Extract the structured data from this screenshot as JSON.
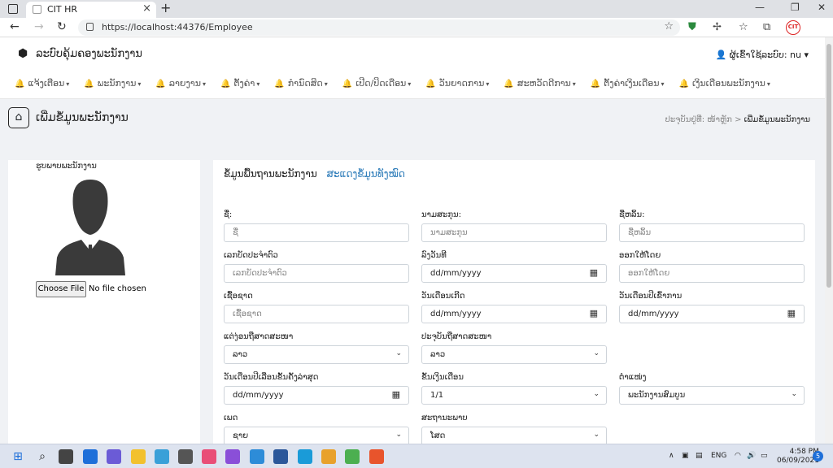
{
  "browser": {
    "tab_title": "CIT HR",
    "url": "https://localhost:44376/Employee",
    "new_tab_label": "+",
    "close_tab_label": "×",
    "profile_badge": "CIT"
  },
  "app": {
    "brand": "ລະບົບຄຸ້ມຄອງພະນັກງານ",
    "user_label": "ຜູ້ເຂົ້າໃຊ້ລະບົບ: nu"
  },
  "menu": [
    {
      "label": "ແຈ້ງເຕືອນ"
    },
    {
      "label": "ພະນັກງານ"
    },
    {
      "label": "ລາຍງານ"
    },
    {
      "label": "ຕັ້ງຄ່າ"
    },
    {
      "label": "ກຳນົດສິດ"
    },
    {
      "label": "ເປີດ/ປິດເດືອນ"
    },
    {
      "label": "ວັນຍາດການ"
    },
    {
      "label": "ສະຫວັດດີການ"
    },
    {
      "label": "ຕັ້ງຄ່າເງິນເດືອນ"
    },
    {
      "label": "ເງິນເດືອນພະນັກງານ"
    }
  ],
  "page": {
    "title": "ເພີ່ມຂໍ້ມູນພະນັກງານ",
    "breadcrumb": {
      "item1": "ປະຈຸບັນຢູ່ທີ່:",
      "item2": "ໜ້າຫຼັກ",
      "separator": ">",
      "active": "ເພີ່ມຂໍ້ມູນພະນັກງານ"
    }
  },
  "photo": {
    "label": "ຮູບພາບພະນັກງານ",
    "choose_button": "Choose File",
    "no_file": "No file chosen"
  },
  "form": {
    "tab_active": "ຂໍ້ມູນພື້ນຖານພະນັກງານ",
    "tab_link": "ສະແດງຂໍ້ມູນທັງໝົດ",
    "fields": {
      "first_name": {
        "label": "ຊື່:",
        "placeholder": "ຊື່"
      },
      "last_name": {
        "label": "ນາມສະກຸນ:",
        "placeholder": "ນາມສະກຸນ"
      },
      "nickname": {
        "label": "ຊື່ຫລິ້ນ:",
        "placeholder": "ຊື່ຫລິ້ນ"
      },
      "id_card": {
        "label": "ເລກບັດປະຈຳຕົວ",
        "placeholder": "ເລກບັດປະຈຳຕົວ"
      },
      "valid_date": {
        "label": "ລົງວັນທີ",
        "placeholder": "dd/mm/yyyy"
      },
      "issued_by": {
        "label": "ອອກໃຫ້ໂດຍ",
        "placeholder": "ອອກໃຫ້ໂດຍ"
      },
      "ethnicity": {
        "label": "ເຊື້ອຊາດ",
        "placeholder": "ເຊື້ອຊາດ"
      },
      "birth_date": {
        "label": "ວັນເດືອນເກີດ",
        "placeholder": "dd/mm/yyyy"
      },
      "start_date": {
        "label": "ວັນເດືອນປີເຂົ້າການ",
        "placeholder": "dd/mm/yyyy"
      },
      "religion": {
        "label": "ແຕ່ງ່ອນຖືສາດສະໜາ",
        "value": "ລາວ"
      },
      "current_religion": {
        "label": "ປະຈຸບັນຖືສາດສະໜາ",
        "value": "ລາວ"
      },
      "last_raise_date": {
        "label": "ວັນເດືອນປີເລື່ອນຂັ້ນຄັ້ງລ່າສຸດ",
        "placeholder": "dd/mm/yyyy"
      },
      "salary_level": {
        "label": "ຂັ້ນເງິນເດືອນ",
        "value": "1/1"
      },
      "position": {
        "label": "ຕຳແໜ່ງ",
        "value": "ພະນັກງານສົມບູນ"
      },
      "gender": {
        "label": "ເພດ",
        "value": "ຊາຍ"
      },
      "marital_status": {
        "label": "ສະຖານະພາບ",
        "value": "ໂສດ"
      }
    }
  },
  "taskbar": {
    "lang": "ENG",
    "time": "4:58 PM",
    "date": "06/09/2021",
    "notifications": "5"
  }
}
